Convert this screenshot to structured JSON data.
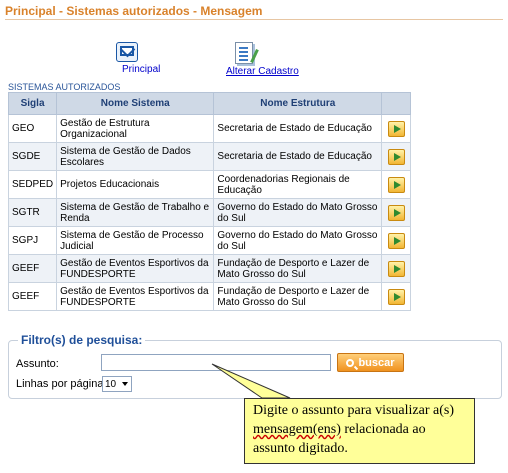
{
  "page": {
    "title": "Principal - Sistemas autorizados - Mensagem"
  },
  "nav": {
    "principal_label": "Principal",
    "principal_icon": "envelope-icon",
    "alterar_label": "Alterar Cadastro",
    "alterar_icon": "edit-document-icon"
  },
  "systems": {
    "section_label": "SISTEMAS AUTORIZADOS",
    "headers": [
      "Sigla",
      "Nome Sistema",
      "Nome Estrutura",
      ""
    ],
    "rows": [
      {
        "sigla": "GEO",
        "nome_sistema": "Gestão de Estrutura Organizacional",
        "nome_estrutura": "Secretaria de Estado de Educação"
      },
      {
        "sigla": "SGDE",
        "nome_sistema": "Sistema de Gestão de Dados Escolares",
        "nome_estrutura": "Secretaria de Estado de Educação"
      },
      {
        "sigla": "SEDPED",
        "nome_sistema": "Projetos Educacionais",
        "nome_estrutura": "Coordenadorias Regionais de Educação"
      },
      {
        "sigla": "SGTR",
        "nome_sistema": "Sistema de Gestão de Trabalho e Renda",
        "nome_estrutura": "Governo do Estado do Mato Grosso do Sul"
      },
      {
        "sigla": "SGPJ",
        "nome_sistema": "Sistema de Gestão de Processo Judicial",
        "nome_estrutura": "Governo do Estado do Mato Grosso do Sul"
      },
      {
        "sigla": "GEEF",
        "nome_sistema": "Gestão de Eventos Esportivos da FUNDESPORTE",
        "nome_estrutura": "Fundação de Desporto e Lazer de Mato Grosso do Sul"
      },
      {
        "sigla": "GEEF",
        "nome_sistema": "Gestão de Eventos Esportivos da FUNDESPORTE",
        "nome_estrutura": "Fundação de Desporto e Lazer de Mato Grosso do Sul"
      }
    ],
    "action_icon": "play-arrow-icon"
  },
  "filter": {
    "title": "Filtro(s) de pesquisa:",
    "assunto_label": "Assunto:",
    "assunto_value": "",
    "buscar_label": "buscar",
    "linhas_label": "Linhas por página:",
    "linhas_value": "10"
  },
  "tooltip": {
    "line1": "Digite o assunto para visualizar a(s)",
    "line2_word": "mensagem(ens)",
    "line2_rest": " relacionada ao",
    "line3": "assunto digitado."
  },
  "colors": {
    "title": "#d9822b",
    "header_bg": "#cfd9e6",
    "tooltip_bg": "#ffff99",
    "button_orange": "#f0921f"
  }
}
